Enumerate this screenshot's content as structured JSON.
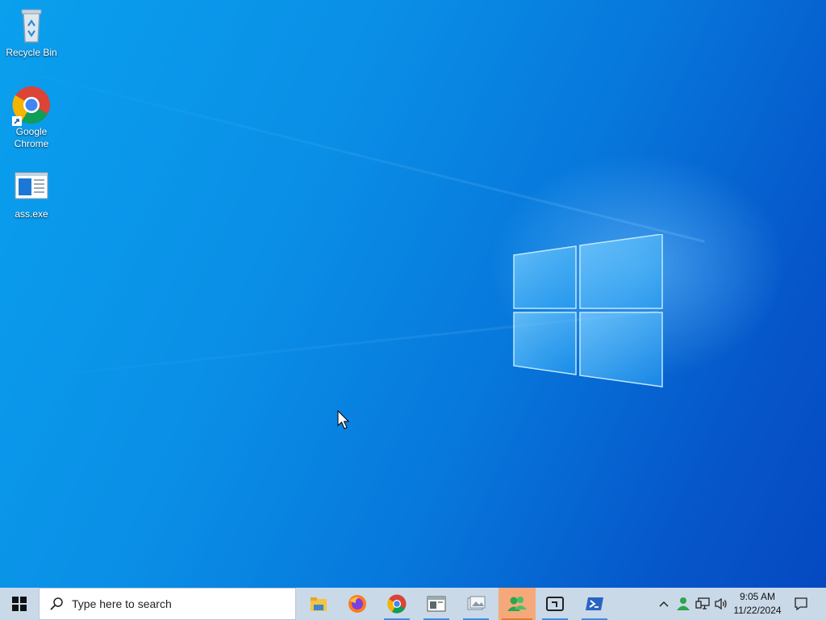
{
  "desktop": {
    "icons": [
      {
        "label": "Recycle Bin",
        "icon": "recycle-bin-icon"
      },
      {
        "label": "Google Chrome",
        "icon": "chrome-icon"
      },
      {
        "label": "ass.exe",
        "icon": "exe-file-icon"
      }
    ],
    "wallpaper": "windows-10-logo",
    "colors": {
      "accent": "#0a8fe6",
      "deep": "#0549c0"
    }
  },
  "taskbar": {
    "search_placeholder": "Type here to search",
    "apps": [
      {
        "name": "file-explorer-icon",
        "running": false
      },
      {
        "name": "firefox-icon",
        "running": false
      },
      {
        "name": "chrome-icon",
        "running": true
      },
      {
        "name": "window-app-icon",
        "running": true
      },
      {
        "name": "images-app-icon",
        "running": true
      },
      {
        "name": "users-app-icon",
        "running": true,
        "active": true
      },
      {
        "name": "terminal-box-icon",
        "running": true
      },
      {
        "name": "powershell-icon",
        "running": true
      }
    ],
    "tray": {
      "icons": [
        "chevron-up-icon",
        "user-status-icon",
        "network-icon",
        "volume-icon"
      ],
      "time": "9:05 AM",
      "date": "11/22/2024",
      "notifications_icon": "notification-icon"
    }
  }
}
